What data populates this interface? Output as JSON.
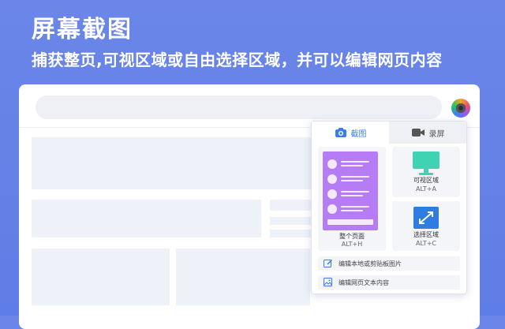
{
  "headline": "屏幕截图",
  "subline": "捕获整页,可视区域或自由选择区域，并可以编辑网页内容",
  "popup": {
    "tabs": [
      {
        "label": "截图",
        "icon": "camera-icon",
        "active": true
      },
      {
        "label": "录屏",
        "icon": "video-camera-icon",
        "active": false
      }
    ],
    "cards": {
      "full_page": {
        "label": "整个页面",
        "shortcut": "ALT+H"
      },
      "visible_area": {
        "label": "可视区域",
        "shortcut": "ALT+A"
      },
      "select_area": {
        "label": "选择区域",
        "shortcut": "ALT+C"
      }
    },
    "actions": [
      {
        "label": "编辑本地或剪贴板图片",
        "icon": "edit-icon"
      },
      {
        "label": "编辑网页文本内容",
        "icon": "image-edit-icon"
      }
    ]
  },
  "colors": {
    "background": "#6b86e8",
    "accent": "#3a7cf0",
    "purple": "#b57cf5",
    "teal": "#3fd3b4",
    "blue": "#2f7de1"
  }
}
